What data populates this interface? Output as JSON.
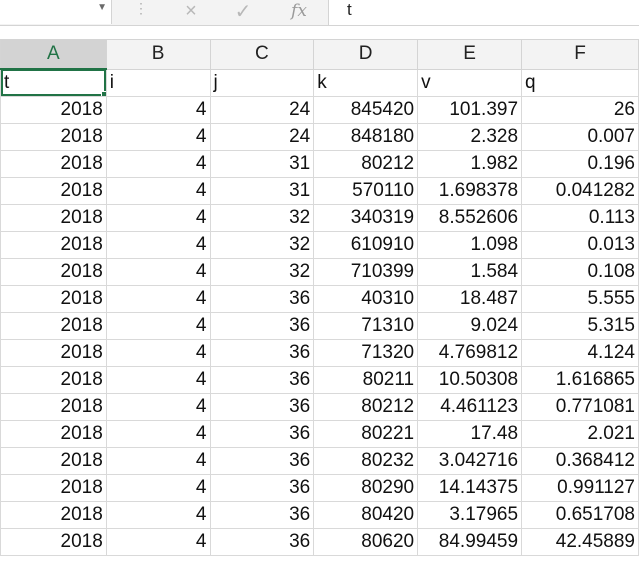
{
  "formula_bar": {
    "namebox_value": "",
    "cancel_icon": "×",
    "enter_icon": "✓",
    "fx_label": "fx",
    "content": "t"
  },
  "sheet": {
    "columns": [
      "A",
      "B",
      "C",
      "D",
      "E",
      "F"
    ],
    "selected_column": "A",
    "header_row": [
      "t",
      "i",
      "j",
      "k",
      "v",
      "q"
    ],
    "rows": [
      [
        "2018",
        "4",
        "24",
        "845420",
        "101.397",
        "26"
      ],
      [
        "2018",
        "4",
        "24",
        "848180",
        "2.328",
        "0.007"
      ],
      [
        "2018",
        "4",
        "31",
        "80212",
        "1.982",
        "0.196"
      ],
      [
        "2018",
        "4",
        "31",
        "570110",
        "1.698378",
        "0.041282"
      ],
      [
        "2018",
        "4",
        "32",
        "340319",
        "8.552606",
        "0.113"
      ],
      [
        "2018",
        "4",
        "32",
        "610910",
        "1.098",
        "0.013"
      ],
      [
        "2018",
        "4",
        "32",
        "710399",
        "1.584",
        "0.108"
      ],
      [
        "2018",
        "4",
        "36",
        "40310",
        "18.487",
        "5.555"
      ],
      [
        "2018",
        "4",
        "36",
        "71310",
        "9.024",
        "5.315"
      ],
      [
        "2018",
        "4",
        "36",
        "71320",
        "4.769812",
        "4.124"
      ],
      [
        "2018",
        "4",
        "36",
        "80211",
        "10.50308",
        "1.616865"
      ],
      [
        "2018",
        "4",
        "36",
        "80212",
        "4.461123",
        "0.771081"
      ],
      [
        "2018",
        "4",
        "36",
        "80221",
        "17.48",
        "2.021"
      ],
      [
        "2018",
        "4",
        "36",
        "80232",
        "3.042716",
        "0.368412"
      ],
      [
        "2018",
        "4",
        "36",
        "80290",
        "14.14375",
        "0.991127"
      ],
      [
        "2018",
        "4",
        "36",
        "80420",
        "3.17965",
        "0.651708"
      ],
      [
        "2018",
        "4",
        "36",
        "80620",
        "84.99459",
        "42.45889"
      ]
    ]
  }
}
